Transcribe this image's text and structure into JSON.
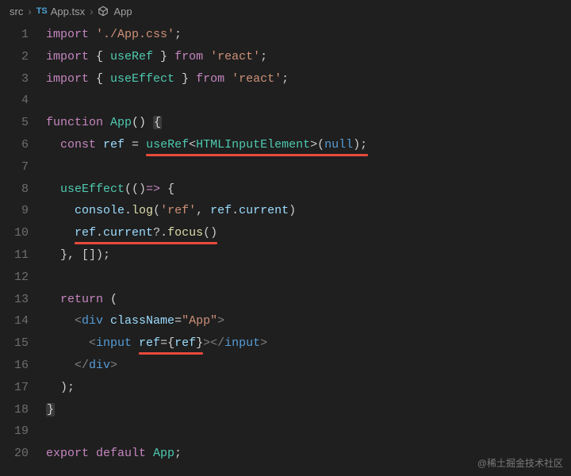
{
  "breadcrumb": {
    "items": [
      "src",
      "App.tsx",
      "App"
    ],
    "lang_badge": "TS"
  },
  "gutter": {
    "start": 1,
    "end": 20
  },
  "code": {
    "l1": [
      {
        "t": "import ",
        "c": "kw"
      },
      {
        "t": "'./App.css'",
        "c": "str"
      },
      {
        "t": ";",
        "c": "pun"
      }
    ],
    "l2": [
      {
        "t": "import ",
        "c": "kw"
      },
      {
        "t": "{ ",
        "c": "brk"
      },
      {
        "t": "useRef",
        "c": "fn"
      },
      {
        "t": " } ",
        "c": "brk"
      },
      {
        "t": "from ",
        "c": "kw"
      },
      {
        "t": "'react'",
        "c": "str"
      },
      {
        "t": ";",
        "c": "pun"
      }
    ],
    "l3": [
      {
        "t": "import ",
        "c": "kw"
      },
      {
        "t": "{ ",
        "c": "brk"
      },
      {
        "t": "useEffect",
        "c": "fn"
      },
      {
        "t": " } ",
        "c": "brk"
      },
      {
        "t": "from ",
        "c": "kw"
      },
      {
        "t": "'react'",
        "c": "str"
      },
      {
        "t": ";",
        "c": "pun"
      }
    ],
    "l4": [],
    "l5": [
      {
        "t": "function ",
        "c": "kw"
      },
      {
        "t": "App",
        "c": "fn"
      },
      {
        "t": "() ",
        "c": "brk"
      },
      {
        "t": "{",
        "c": "brk glow"
      }
    ],
    "l6": [
      {
        "t": "  ",
        "c": ""
      },
      {
        "t": "const ",
        "c": "kw"
      },
      {
        "t": "ref",
        "c": "var"
      },
      {
        "t": " = ",
        "c": "pun"
      },
      {
        "t": "useRef",
        "c": "fn"
      },
      {
        "t": "<",
        "c": "pun"
      },
      {
        "t": "HTMLInputElement",
        "c": "type"
      },
      {
        "t": ">(",
        "c": "pun"
      },
      {
        "t": "null",
        "c": "null"
      },
      {
        "t": ");",
        "c": "pun"
      }
    ],
    "l7": [],
    "l8": [
      {
        "t": "  ",
        "c": ""
      },
      {
        "t": "useEffect",
        "c": "fn"
      },
      {
        "t": "(()",
        "c": "pun"
      },
      {
        "t": "=>",
        "c": "kw"
      },
      {
        "t": " {",
        "c": "brk"
      }
    ],
    "l9": [
      {
        "t": "    ",
        "c": ""
      },
      {
        "t": "console",
        "c": "var"
      },
      {
        "t": ".",
        "c": "pun"
      },
      {
        "t": "log",
        "c": "varf"
      },
      {
        "t": "(",
        "c": "pun"
      },
      {
        "t": "'ref'",
        "c": "str"
      },
      {
        "t": ", ",
        "c": "pun"
      },
      {
        "t": "ref",
        "c": "var"
      },
      {
        "t": ".",
        "c": "pun"
      },
      {
        "t": "current",
        "c": "var"
      },
      {
        "t": ")",
        "c": "pun"
      }
    ],
    "l10": [
      {
        "t": "    ",
        "c": ""
      },
      {
        "t": "ref",
        "c": "var"
      },
      {
        "t": ".",
        "c": "pun"
      },
      {
        "t": "current",
        "c": "var"
      },
      {
        "t": "?.",
        "c": "pun"
      },
      {
        "t": "focus",
        "c": "varf"
      },
      {
        "t": "()",
        "c": "pun"
      }
    ],
    "l11": [
      {
        "t": "  ",
        "c": ""
      },
      {
        "t": "}, []);",
        "c": "pun"
      }
    ],
    "l12": [],
    "l13": [
      {
        "t": "  ",
        "c": ""
      },
      {
        "t": "return ",
        "c": "kw"
      },
      {
        "t": "(",
        "c": "brk"
      }
    ],
    "l14": [
      {
        "t": "    ",
        "c": ""
      },
      {
        "t": "<",
        "c": "tagp"
      },
      {
        "t": "div ",
        "c": "tag"
      },
      {
        "t": "className",
        "c": "attr"
      },
      {
        "t": "=",
        "c": "pun"
      },
      {
        "t": "\"App\"",
        "c": "str"
      },
      {
        "t": ">",
        "c": "tagp"
      }
    ],
    "l15": [
      {
        "t": "      ",
        "c": ""
      },
      {
        "t": "<",
        "c": "tagp"
      },
      {
        "t": "input ",
        "c": "tag"
      },
      {
        "t": "ref",
        "c": "attr"
      },
      {
        "t": "=",
        "c": "pun"
      },
      {
        "t": "{",
        "c": "brk"
      },
      {
        "t": "ref",
        "c": "var"
      },
      {
        "t": "}",
        "c": "brk"
      },
      {
        "t": "></",
        "c": "tagp"
      },
      {
        "t": "input",
        "c": "tag"
      },
      {
        "t": ">",
        "c": "tagp"
      }
    ],
    "l16": [
      {
        "t": "    ",
        "c": ""
      },
      {
        "t": "</",
        "c": "tagp"
      },
      {
        "t": "div",
        "c": "tag"
      },
      {
        "t": ">",
        "c": "tagp"
      }
    ],
    "l17": [
      {
        "t": "  ",
        "c": ""
      },
      {
        "t": ");",
        "c": "pun"
      }
    ],
    "l18": [
      {
        "t": "}",
        "c": "brk glow"
      }
    ],
    "l19": [],
    "l20": [
      {
        "t": "export default ",
        "c": "kw"
      },
      {
        "t": "App",
        "c": "fn"
      },
      {
        "t": ";",
        "c": "pun"
      }
    ]
  },
  "annotations": [
    {
      "line": 6,
      "left_ch": 14,
      "width_ch": 31
    },
    {
      "line": 10,
      "left_ch": 4,
      "width_ch": 20
    },
    {
      "line": 15,
      "left_ch": 13,
      "width_ch": 9
    }
  ],
  "watermark": "@稀土掘金技术社区"
}
